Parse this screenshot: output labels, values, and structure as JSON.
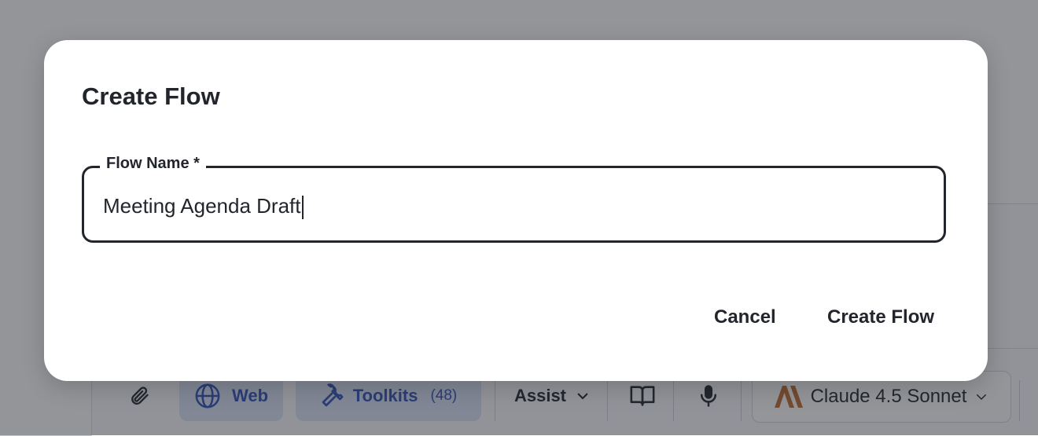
{
  "dialog": {
    "title": "Create Flow",
    "field_label": "Flow Name *",
    "field_value": "Meeting Agenda Draft",
    "cancel_label": "Cancel",
    "create_label": "Create Flow"
  },
  "toolbar": {
    "web_label": "Web",
    "toolkits_label": "Toolkits",
    "toolkits_count": "(48)",
    "assist_label": "Assist",
    "model_label": "Claude 4.5 Sonnet",
    "icons": [
      "paperclip-icon",
      "globe-icon",
      "wrench-icon",
      "chevron-down-icon",
      "book-icon",
      "microphone-icon",
      "anthropic-logo",
      "chevron-down-icon"
    ]
  },
  "colors": {
    "accent": "#2c4fb8",
    "accent_bg": "#dbe3f6",
    "text": "#22262c",
    "brand": "#c06a2a"
  }
}
